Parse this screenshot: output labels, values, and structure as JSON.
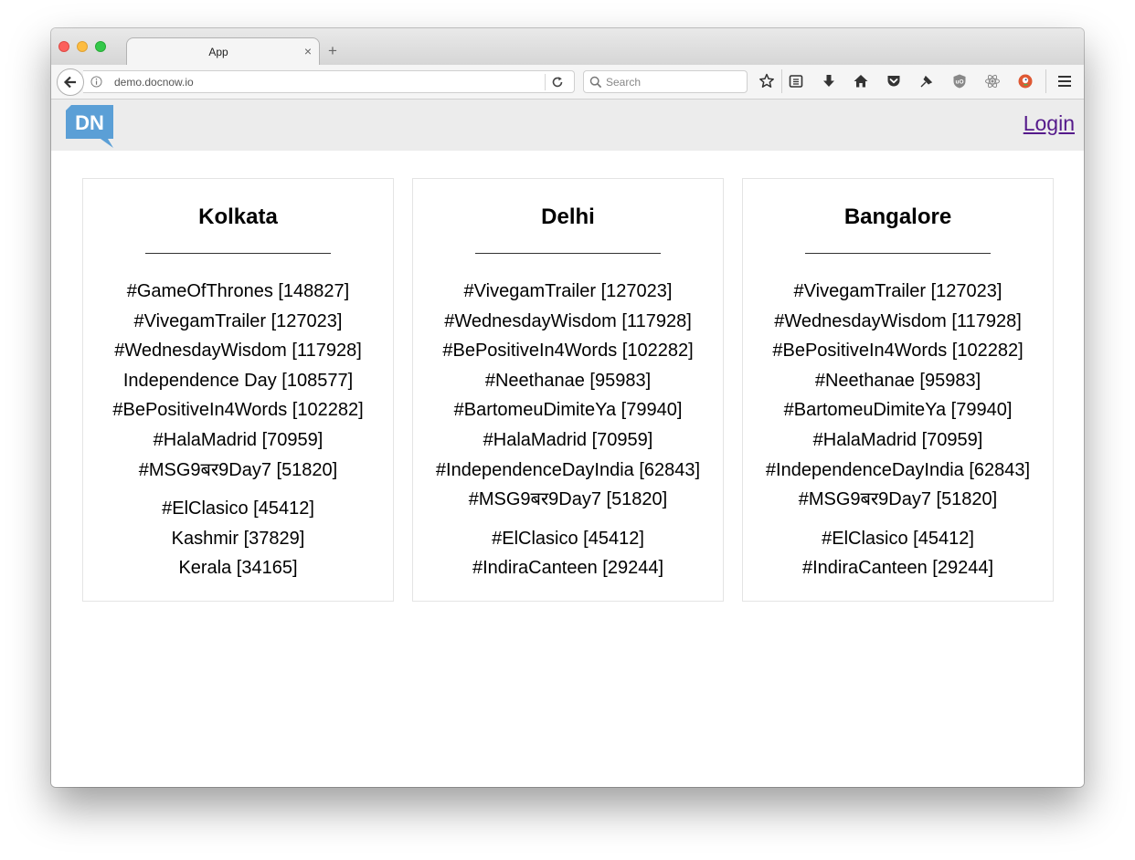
{
  "browser": {
    "tab_title": "App",
    "tab_close": "×",
    "new_tab": "+",
    "url": "demo.docnow.io",
    "search_placeholder": "Search"
  },
  "toolbar_icons": [
    "back-arrow-icon",
    "info-icon",
    "reload-icon",
    "search-icon",
    "bookmark-star-icon",
    "reading-list-icon",
    "download-icon",
    "home-icon",
    "pocket-icon",
    "pin-icon",
    "ublock-icon",
    "react-devtools-icon",
    "duckduckgo-icon",
    "hamburger-menu-icon"
  ],
  "header": {
    "logo_text": "DN",
    "login_label": "Login"
  },
  "colors": {
    "logo_blue": "#5b9fd6",
    "link_purple": "#551a8b",
    "header_bg": "#ececec"
  },
  "places": [
    {
      "name": "Kolkata",
      "trends": [
        "#GameOfThrones [148827]",
        "#VivegamTrailer [127023]",
        "#WednesdayWisdom [117928]",
        "Independence Day [108577]",
        "#BePositiveIn4Words [102282]",
        "#HalaMadrid [70959]",
        "#MSG9बर9Day7 [51820]",
        "#ElClasico [45412]",
        "Kashmir [37829]",
        "Kerala [34165]"
      ]
    },
    {
      "name": "Delhi",
      "trends": [
        "#VivegamTrailer [127023]",
        "#WednesdayWisdom [117928]",
        "#BePositiveIn4Words [102282]",
        "#Neethanae [95983]",
        "#BartomeuDimiteYa [79940]",
        "#HalaMadrid [70959]",
        "#IndependenceDayIndia [62843]",
        "#MSG9बर9Day7 [51820]",
        "#ElClasico [45412]",
        "#IndiraCanteen [29244]"
      ]
    },
    {
      "name": "Bangalore",
      "trends": [
        "#VivegamTrailer [127023]",
        "#WednesdayWisdom [117928]",
        "#BePositiveIn4Words [102282]",
        "#Neethanae [95983]",
        "#BartomeuDimiteYa [79940]",
        "#HalaMadrid [70959]",
        "#IndependenceDayIndia [62843]",
        "#MSG9बर9Day7 [51820]",
        "#ElClasico [45412]",
        "#IndiraCanteen [29244]"
      ]
    }
  ]
}
